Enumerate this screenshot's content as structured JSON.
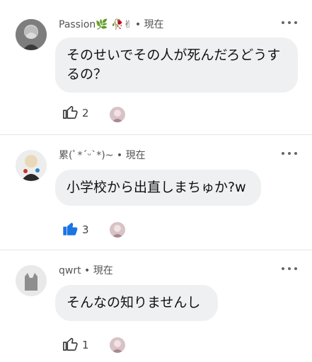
{
  "comments": [
    {
      "author": "Passion🌿 🥀✌︎",
      "time": "現在",
      "text": "そのせいでその人が死んだろどうするの？",
      "likes": "2",
      "liked": false
    },
    {
      "author": "累(ﾟ*´ᵕ`*)~",
      "time": "現在",
      "text": "小学校から出直しまちゅか?w",
      "likes": "3",
      "liked": true
    },
    {
      "author": "qwrt",
      "time": "現在",
      "text": "そんなの知りませんし",
      "likes": "1",
      "liked": false
    }
  ],
  "colors": {
    "liked": "#1b74e4",
    "like_outline": "#333333",
    "bubble": "#eff0f2",
    "divider": "#e4e4e4"
  },
  "icons": {
    "like": "thumbs-up-icon",
    "menu": "more-dots-icon",
    "default_avatar": "cat-silhouette-icon"
  }
}
